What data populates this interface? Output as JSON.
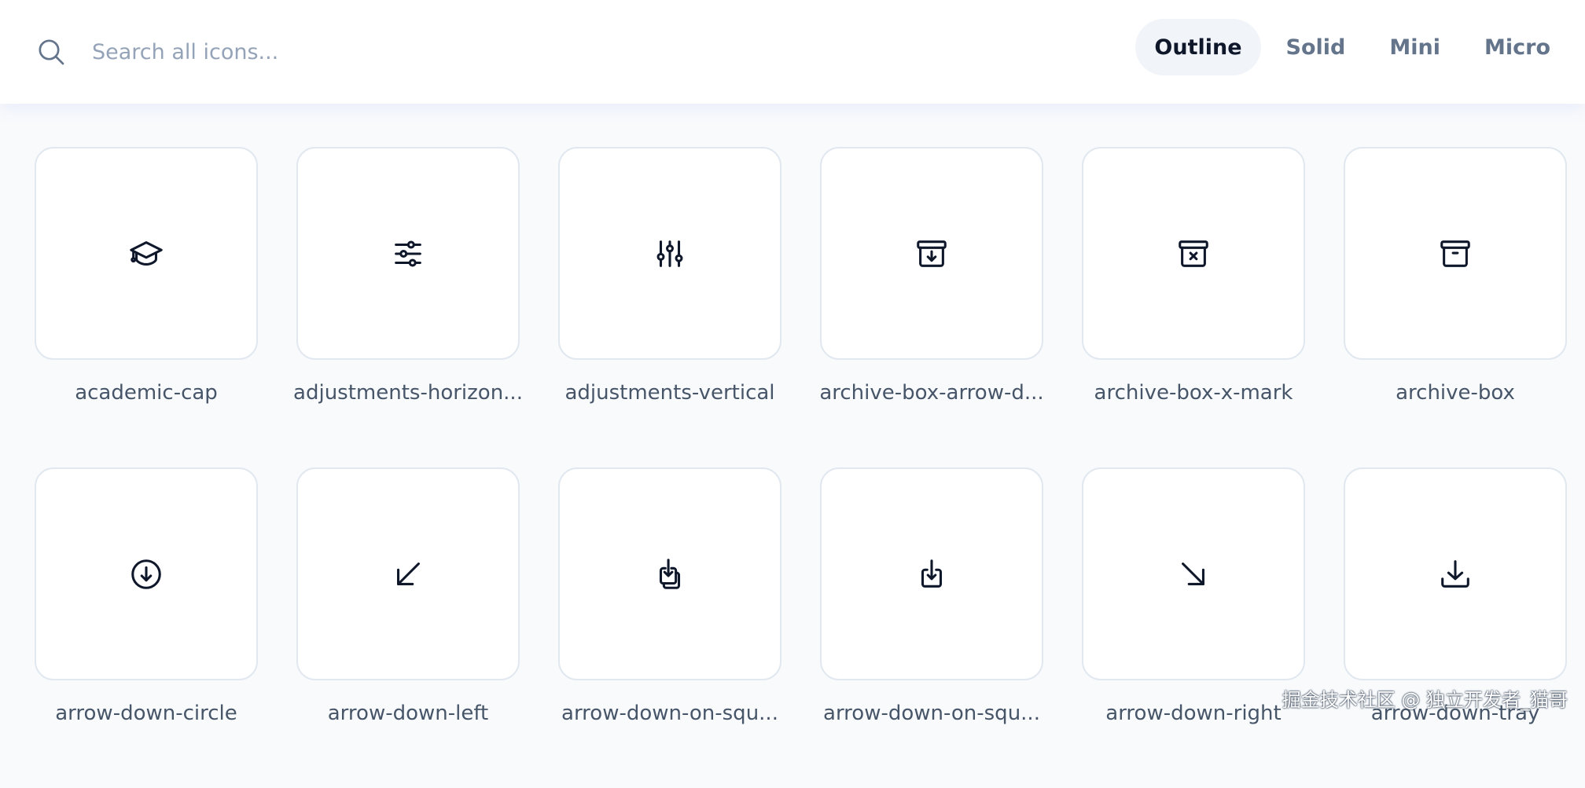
{
  "search": {
    "placeholder": "Search all icons...",
    "icon": "search-icon"
  },
  "tabs": [
    {
      "label": "Outline",
      "active": true
    },
    {
      "label": "Solid",
      "active": false
    },
    {
      "label": "Mini",
      "active": false
    },
    {
      "label": "Micro",
      "active": false
    }
  ],
  "icons": [
    {
      "label": "academic-cap",
      "icon": "academic-cap-icon"
    },
    {
      "label": "adjustments-horizon...",
      "icon": "adjustments-horizontal-icon"
    },
    {
      "label": "adjustments-vertical",
      "icon": "adjustments-vertical-icon"
    },
    {
      "label": "archive-box-arrow-d...",
      "icon": "archive-box-arrow-down-icon"
    },
    {
      "label": "archive-box-x-mark",
      "icon": "archive-box-x-mark-icon"
    },
    {
      "label": "archive-box",
      "icon": "archive-box-icon"
    },
    {
      "label": "arrow-down-circle",
      "icon": "arrow-down-circle-icon"
    },
    {
      "label": "arrow-down-left",
      "icon": "arrow-down-left-icon"
    },
    {
      "label": "arrow-down-on-squ...",
      "icon": "arrow-down-on-square-stack-icon"
    },
    {
      "label": "arrow-down-on-squ...",
      "icon": "arrow-down-on-square-icon"
    },
    {
      "label": "arrow-down-right",
      "icon": "arrow-down-right-icon"
    },
    {
      "label": "arrow-down-tray",
      "icon": "arrow-down-tray-icon"
    }
  ],
  "watermark": "掘金技术社区 @ 独立开发者_猫哥",
  "colors": {
    "accent_tab_bg": "#f1f5f9",
    "card_border": "#e2e8f0",
    "label_text": "#475569",
    "icon_stroke": "#0f172a"
  }
}
